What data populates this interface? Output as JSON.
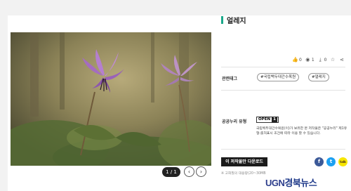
{
  "page": {
    "title": "얼레지",
    "accent_color": "#1aa88a"
  },
  "viewer": {
    "pager": "1 / 1",
    "prev_icon": "chevron-left-icon",
    "next_icon": "chevron-right-icon"
  },
  "stats": {
    "likes": "0",
    "views": "1",
    "downloads": "0"
  },
  "tags": {
    "label": "관련태그",
    "items": [
      "#국립백두대간수목원",
      "#얼레지"
    ]
  },
  "license": {
    "label": "공공누리 유형",
    "badge_left": "OPEN",
    "badge_right": "1",
    "text": "국립백두대간수목원(이)가 보유한 본 저작물은 \"공공누리\" 제1유형:출처표시 조건에 따라 이용 할 수 있습니다."
  },
  "download": {
    "button_label": "이 저작물만 다운로드",
    "notice": "※ 고화질의 대용량(20~30MB"
  },
  "share": {
    "facebook": "f",
    "twitter": "t",
    "kakao": "talk"
  },
  "watermark": {
    "brand": "UGN",
    "rest": "경북뉴스"
  }
}
